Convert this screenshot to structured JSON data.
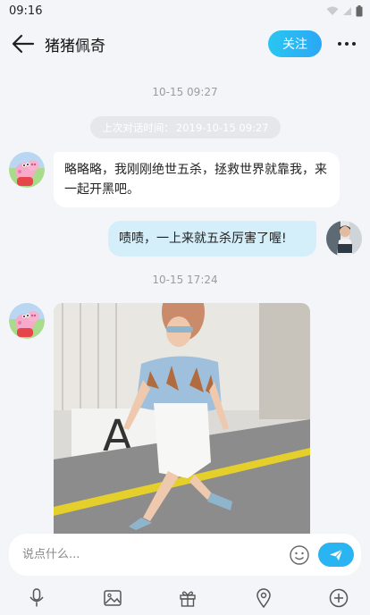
{
  "status_bar": {
    "time": "09:16"
  },
  "header": {
    "title": "猪猪佩奇",
    "follow_label": "关注"
  },
  "messages": {
    "time_1": "10-15 09:27",
    "last_chat_prefix": "上次对话时间：",
    "last_chat_time": "2019-10-15 09:27",
    "received_1": "略略略，我刚刚绝世五杀，拯救世界就靠我，来一起开黑吧。",
    "sent_1": "啧啧，一上来就五杀厉害了喔!",
    "time_2": "10-15 17:24"
  },
  "input": {
    "placeholder": "说点什么..."
  },
  "icons": {
    "back": "back-arrow-icon",
    "more": "more-dots-icon",
    "emoji": "smiley-icon",
    "send": "paper-plane-icon",
    "toolbar": [
      "microphone-icon",
      "image-icon",
      "gift-icon",
      "location-pin-icon",
      "plus-circle-icon"
    ]
  },
  "colors": {
    "accent": "#2ab4f1",
    "sent_bubble": "#d4eefa",
    "background": "#f4f5f9"
  }
}
